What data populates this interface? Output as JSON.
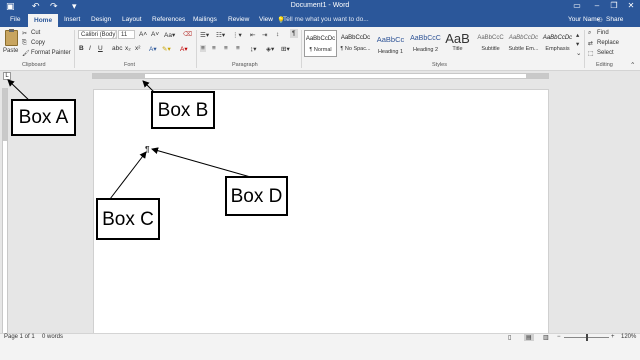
{
  "titlebar": {
    "title": "Document1 - Word",
    "save_icon": "save-icon",
    "undo_icon": "undo-icon",
    "redo_icon": "redo-icon",
    "customize_icon": "customize-icon",
    "ribbon_display_icon": "ribbon-display-icon",
    "minimize_icon": "minimize-icon",
    "restore_icon": "restore-icon",
    "close_icon": "close-icon"
  },
  "tabs": {
    "items": [
      "File",
      "Home",
      "Insert",
      "Design",
      "Layout",
      "References",
      "Mailings",
      "Review",
      "View"
    ],
    "tell_me": "Tell me what you want to do...",
    "user": "Your Name",
    "share": "Share"
  },
  "clipboard": {
    "paste": "Paste",
    "cut": "Cut",
    "copy": "Copy",
    "format_painter": "Format Painter",
    "label": "Clipboard"
  },
  "font": {
    "family": "Calibri (Body)",
    "size": "11",
    "label": "Font"
  },
  "paragraph": {
    "label": "Paragraph"
  },
  "styles": {
    "label": "Styles",
    "items": [
      {
        "sample": "AaBbCcDc",
        "name": "¶ Normal"
      },
      {
        "sample": "AaBbCcDc",
        "name": "¶ No Spac..."
      },
      {
        "sample": "AaBbCc",
        "name": "Heading 1"
      },
      {
        "sample": "AaBbCcC",
        "name": "Heading 2"
      },
      {
        "sample": "AaB",
        "name": "Title"
      },
      {
        "sample": "AaBbCcC",
        "name": "Subtitle"
      },
      {
        "sample": "AaBbCcDc",
        "name": "Subtle Em..."
      },
      {
        "sample": "AaBbCcDc",
        "name": "Emphasis"
      }
    ]
  },
  "editing": {
    "find": "Find",
    "replace": "Replace",
    "select": "Select",
    "label": "Editing"
  },
  "document": {
    "pilcrow": "¶"
  },
  "status": {
    "page": "Page 1 of 1",
    "words": "0 words",
    "zoom": "120%",
    "zoom_level": 1.2
  },
  "annotations": {
    "box_a": "Box A",
    "box_b": "Box B",
    "box_c": "Box C",
    "box_d": "Box D"
  }
}
